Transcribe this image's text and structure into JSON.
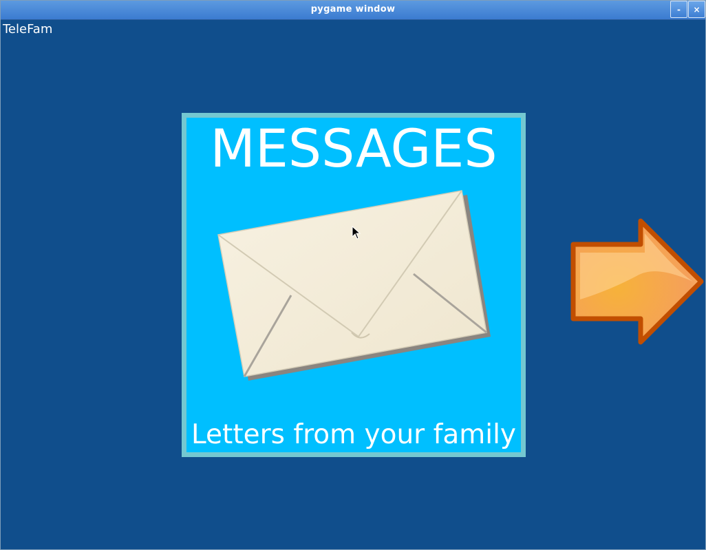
{
  "window": {
    "title": "pygame window",
    "minimize_label": "-",
    "close_label": "×"
  },
  "app": {
    "name": "TeleFam"
  },
  "card": {
    "title": "MESSAGES",
    "subtitle": "Letters from your family",
    "icon": "envelope-icon"
  },
  "navigation": {
    "next_icon": "arrow-right-icon"
  },
  "colors": {
    "background": "#104e8c",
    "card_fill": "#00bfff",
    "card_border": "#74c8d1",
    "titlebar": "#4a8ad8",
    "arrow_fill": "#f5a623",
    "arrow_outline": "#c14e00",
    "envelope": "#f4ecd8"
  }
}
